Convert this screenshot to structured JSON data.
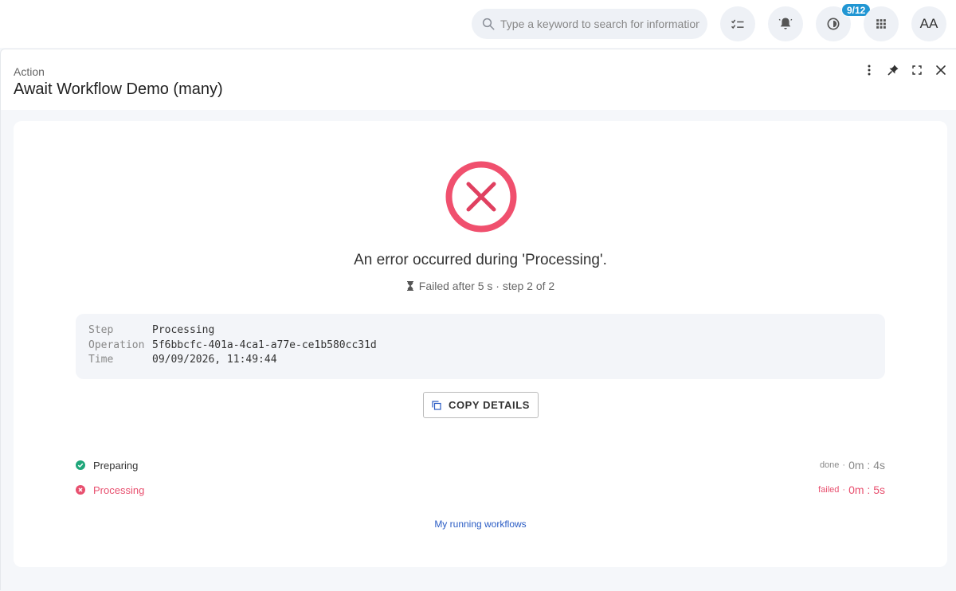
{
  "topbar": {
    "search_placeholder": "Type a keyword to search for information",
    "badge": "9/12",
    "avatar_initials": "AA",
    "icons": [
      "search-icon",
      "checklist-icon",
      "notification-bell-icon",
      "progress-icon",
      "apps-grid-icon"
    ]
  },
  "panel": {
    "subtitle": "Action",
    "title": "Await Workflow Demo (many)",
    "header_icons": [
      "more-vertical-icon",
      "pin-icon",
      "fullscreen-icon",
      "close-icon"
    ]
  },
  "result": {
    "error_message": "An error occurred during 'Processing'.",
    "sub_message": "Failed after 5 s · step 2 of 2",
    "details": [
      {
        "key": "Step",
        "value": "Processing"
      },
      {
        "key": "Operation",
        "value": "5f6bbcfc-401a-4ca1-a77e-ce1b580cc31d"
      },
      {
        "key": "Time",
        "value": "09/09/2026, 11:49:44"
      }
    ],
    "copy_button": "COPY DETAILS",
    "steps": [
      {
        "label": "Preparing",
        "status": "done",
        "time": "0m : 4s"
      },
      {
        "label": "Processing",
        "status": "failed",
        "time": "0m : 5s"
      }
    ],
    "link": "My running workflows"
  },
  "colors": {
    "error": "#f0506e",
    "success": "#1fa67a",
    "accent": "#2196d3",
    "link": "#2a5cc4"
  }
}
